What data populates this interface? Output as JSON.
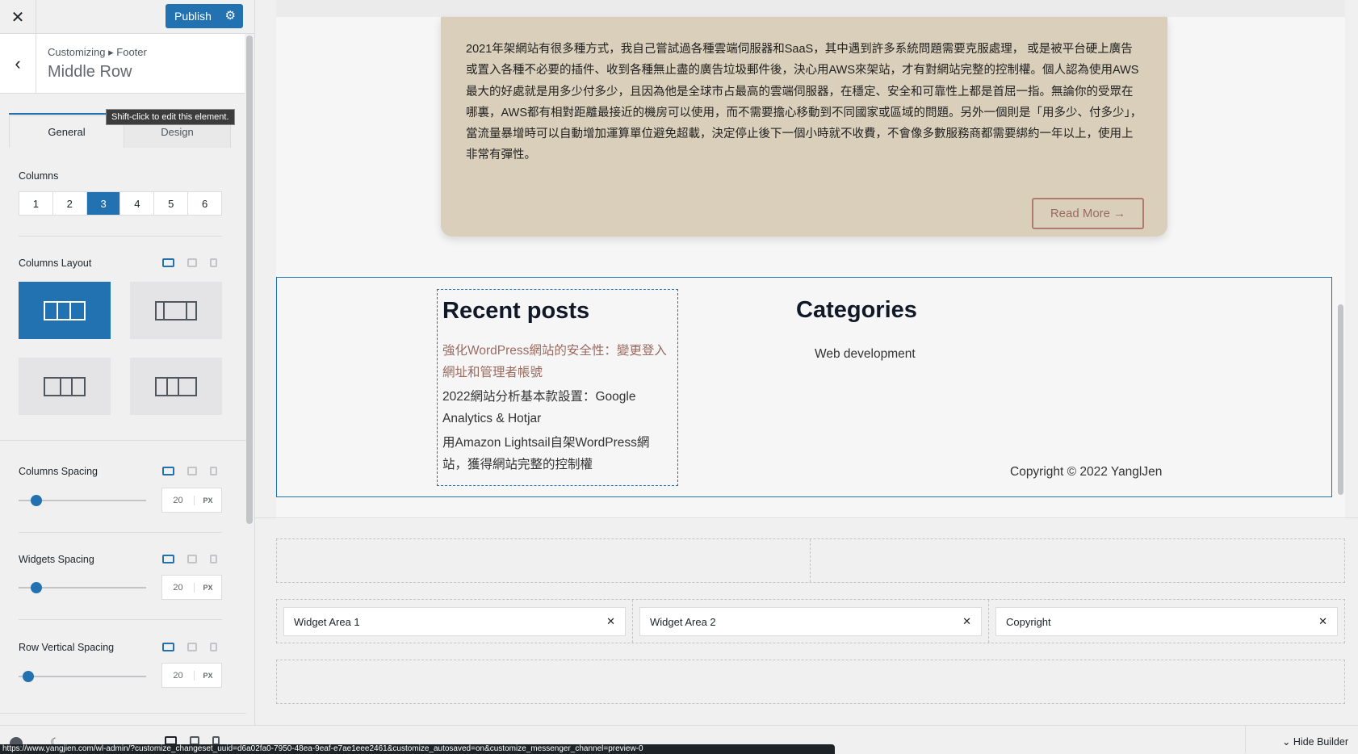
{
  "sidebar": {
    "close_icon": "close-icon",
    "publish": "Publish",
    "publish_settings_icon": "gear-icon",
    "breadcrumb": "Customizing ▸ Footer",
    "title": "Middle Row",
    "tabs": [
      "General",
      "Design"
    ],
    "tooltip": "Shift-click to edit this element.",
    "columns_label": "Columns",
    "columns": [
      "1",
      "2",
      "3",
      "4",
      "5",
      "6"
    ],
    "columns_selected": "3",
    "columns_layout_label": "Columns Layout",
    "spacing": [
      {
        "label": "Columns Spacing",
        "value": "20",
        "unit": "PX"
      },
      {
        "label": "Widgets Spacing",
        "value": "20",
        "unit": "PX"
      },
      {
        "label": "Row Vertical Spacing",
        "value": "20",
        "unit": "PX"
      }
    ]
  },
  "preview": {
    "article": "2021年架網站有很多種方式，我自己嘗試過各種雲端伺服器和SaaS，其中遇到許多系統問題需要克服處理， 或是被平台硬上廣告或置入各種不必要的插件、收到各種無止盡的廣告垃圾郵件後，決心用AWS來架站，才有對網站完整的控制權。個人認為使用AWS最大的好處就是用多少付多少，且因為他是全球市占最高的雲端伺服器，在穩定、安全和可靠性上都是首屈一指。無論你的受眾在哪裏，AWS都有相對距離最接近的機房可以使用，而不需要擔心移動到不同國家或區域的問題。另外一個則是「用多少、付多少」，當流量暴增時可以自動增加運算單位避免超載，決定停止後下一個小時就不收費，不會像多數服務商都需要綁約一年以上，使用上非常有彈性。",
    "read_more": "Read More →",
    "recent_posts_title": "Recent posts",
    "recent_posts": [
      "強化WordPress網站的安全性：變更登入網址和管理者帳號",
      "2022網站分析基本款設置：Google Analytics & Hotjar",
      "用Amazon Lightsail自架WordPress網站，獲得網站完整的控制權"
    ],
    "categories_title": "Categories",
    "categories": [
      "Web development"
    ],
    "copyright": "Copyright © 2022 YanglJen"
  },
  "builder": {
    "widgets": [
      "Widget Area 1",
      "Widget Area 2",
      "Copyright"
    ],
    "hide_builder": "Hide Builder"
  },
  "status_url": "https://www.yangjien.com/wl-admin/?customize_changeset_uuid=d6a02fa0-7950-48ea-9eaf-e7ae1eee2461&customize_autosaved=on&customize_messenger_channel=preview-0",
  "colors": {
    "accent": "#2271b1",
    "card": "#d9cfba",
    "link": "#9a6b60"
  }
}
